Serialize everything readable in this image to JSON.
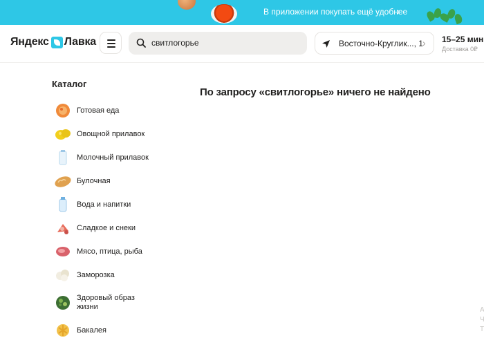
{
  "banner": {
    "text": "В приложении покупать ещё удобнее",
    "arrow": "›"
  },
  "header": {
    "logo_part1": "Яндекс",
    "logo_part2": "Лавка",
    "menu_icon": "hamburger-menu-icon",
    "search": {
      "icon": "search-icon",
      "value": "свитлогорье"
    },
    "address": {
      "icon": "navigation-arrow-icon",
      "text": "Восточно-Круглик..., 1",
      "chevron": "›"
    },
    "delivery": {
      "time": "15–25 мин",
      "cost": "Доставка 0₽"
    }
  },
  "catalog": {
    "title": "Каталог",
    "items": [
      {
        "label": "Готовая еда",
        "icon": "ready-food-icon"
      },
      {
        "label": "Овощной прилавок",
        "icon": "vegetables-icon"
      },
      {
        "label": "Молочный прилавок",
        "icon": "milk-icon"
      },
      {
        "label": "Булочная",
        "icon": "bread-icon"
      },
      {
        "label": "Вода и напитки",
        "icon": "water-bottle-icon"
      },
      {
        "label": "Сладкое и снеки",
        "icon": "sweets-icon"
      },
      {
        "label": "Мясо, птица, рыба",
        "icon": "meat-icon"
      },
      {
        "label": "Заморозка",
        "icon": "frozen-icon"
      },
      {
        "label": "Здоровый образ жизни",
        "icon": "healthy-food-icon"
      },
      {
        "label": "Бакалея",
        "icon": "grocery-icon"
      }
    ]
  },
  "main": {
    "empty_message": "По запросу «свитлогорье» ничего не найдено"
  },
  "colors": {
    "brand_accent": "#2ec7e6",
    "text_primary": "#21201f",
    "text_secondary": "#9e9b98",
    "search_bg": "#efeeec"
  },
  "edge_text": "А Ч Т"
}
